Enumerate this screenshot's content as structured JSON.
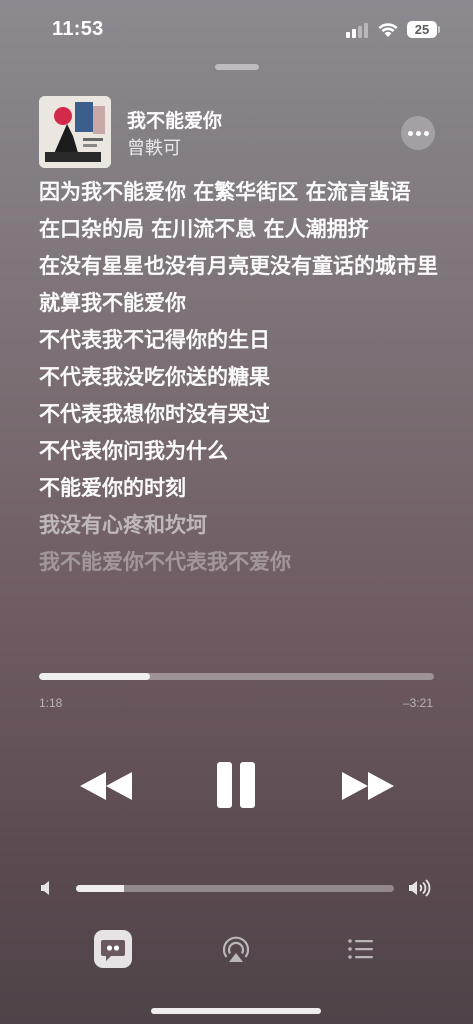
{
  "status_bar": {
    "time": "11:53",
    "battery": "25",
    "signal_bars_active": 2
  },
  "now_playing": {
    "title": "我不能爱你",
    "artist": "曾軼可"
  },
  "lyrics": [
    "因为我不能爱你 在繁华街区 在流言蜚语",
    "在口杂的局  在川流不息 在人潮拥挤",
    "在没有星星也没有月亮更没有童话的城市里",
    "就算我不能爱你",
    "不代表我不记得你的生日",
    "不代表我没吃你送的糖果",
    "不代表我想你时没有哭过",
    "不代表你问我为什么",
    "不能爱你的时刻",
    "我没有心疼和坎坷",
    "我不能爱你不代表我不爱你"
  ],
  "playback": {
    "elapsed": "1:18",
    "remaining": "–3:21",
    "progress_fraction": 0.28
  },
  "volume": {
    "level_fraction": 0.15
  },
  "bottom_bar": {
    "lyrics": "lyrics-icon",
    "airplay": "airplay-icon",
    "queue": "queue-list-icon"
  },
  "colors": {
    "background_top": "#8c8a90",
    "background_bottom": "#4e4348",
    "foreground": "#ffffff"
  }
}
